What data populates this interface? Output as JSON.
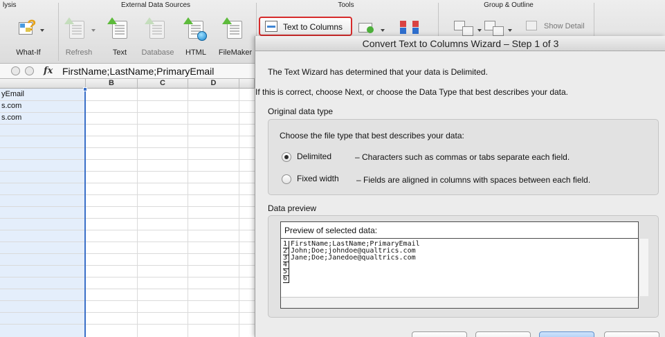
{
  "ribbon": {
    "groups": {
      "analysis": "lysis",
      "external_data": "External Data Sources",
      "tools": "Tools",
      "group_outline": "Group & Outline"
    },
    "buttons": {
      "what_if": "What-If",
      "refresh": "Refresh",
      "text": "Text",
      "database": "Database",
      "html": "HTML",
      "filemaker": "FileMaker",
      "text_to_columns": "Text to Columns",
      "show_detail": "Show Detail"
    }
  },
  "formula_bar": {
    "fx": "fx",
    "value": "FirstName;LastName;PrimaryEmail"
  },
  "sheet": {
    "columns": [
      "B",
      "C",
      "D"
    ],
    "cells": [
      "yEmail",
      "s.com",
      "s.com"
    ]
  },
  "dialog": {
    "title": "Convert Text to Columns Wizard – Step 1 of 3",
    "intro_1": "The Text Wizard has determined that your data is Delimited.",
    "intro_2": "If this is correct, choose Next, or choose the Data Type that best describes your data.",
    "original_type_label": "Original data type",
    "choose_prompt": "Choose the file type that best describes your data:",
    "options": [
      {
        "label": "Delimited",
        "desc": "– Characters such as commas or tabs separate each field.",
        "checked": true
      },
      {
        "label": "Fixed width",
        "desc": "– Fields are aligned in columns with spaces between each field.",
        "checked": false
      }
    ],
    "preview_label": "Data preview",
    "preview_header": "Preview of selected data:",
    "preview_lines": [
      {
        "num": "1",
        "text": "FirstName;LastName;PrimaryEmail"
      },
      {
        "num": "2",
        "text": "John;Doe;johndoe@qualtrics.com"
      },
      {
        "num": "3",
        "text": "Jane;Doe;Janedoe@qualtrics.com"
      },
      {
        "num": "4",
        "text": ""
      },
      {
        "num": "5",
        "text": ""
      },
      {
        "num": "6",
        "text": ""
      }
    ]
  }
}
